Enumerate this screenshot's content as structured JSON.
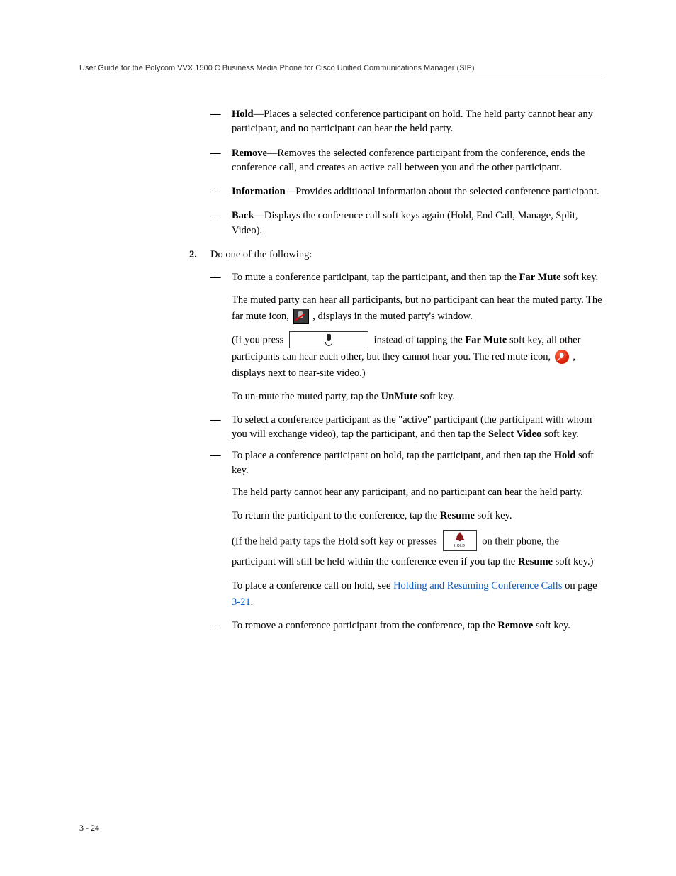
{
  "header": "User Guide for the Polycom VVX 1500 C Business Media Phone for Cisco Unified Communications Manager (SIP)",
  "items": {
    "hold": {
      "term": "Hold",
      "text": "—Places a selected conference participant on hold. The held party cannot hear any participant, and no participant can hear the held party."
    },
    "remove": {
      "term": "Remove",
      "text": "—Removes the selected conference participant from the conference, ends the conference call, and creates an active call between you and the other participant."
    },
    "information": {
      "term": "Information",
      "text": "—Provides additional information about the selected conference participant."
    },
    "back": {
      "term": "Back",
      "text": "—Displays the conference call soft keys again (Hold, End Call, Manage, Split, Video)."
    }
  },
  "step2": {
    "num": "2.",
    "lead": "Do one of the following:",
    "mute": {
      "p1a": "To mute a conference participant, tap the participant, and then tap the ",
      "p1b": "Far Mute",
      "p1c": " soft key.",
      "p2a": "The muted party can hear all participants, but no participant can hear the muted party. The far mute icon, ",
      "p2b": " , displays in the muted party's window.",
      "p3a": "(If you press ",
      "p3b": " instead of tapping the ",
      "p3c": "Far Mute",
      "p3d": " soft key, all other participants can hear each other, but they cannot hear you. The red mute icon, ",
      "p3e": " , displays next to near-site video.)",
      "p4a": "To un-mute the muted party, tap the ",
      "p4b": "UnMute",
      "p4c": " soft key."
    },
    "select": {
      "a": "To select a conference participant as the \"active\" participant (the participant with whom you will exchange video), tap the participant, and then tap the ",
      "b": "Select Video",
      "c": " soft key."
    },
    "holdp": {
      "p1a": "To place a conference participant on hold, tap the participant, and then tap the ",
      "p1b": "Hold",
      "p1c": " soft key.",
      "p2": "The held party cannot hear any participant, and no participant can hear the held party.",
      "p3a": "To return the participant to the conference, tap the ",
      "p3b": "Resume",
      "p3c": " soft key.",
      "p4a": "(If the held party taps the Hold soft key or presses ",
      "p4b": " on their phone, the participant will still be held within the conference even if you tap the ",
      "p4c": "Resume",
      "p4d": " soft key.)",
      "p5a": "To place a conference call on hold, see ",
      "p5link": "Holding and Resuming Conference Calls",
      "p5b": " on page ",
      "p5page": "3-21",
      "p5c": "."
    },
    "removep": {
      "a": "To remove a conference participant from the conference, tap the ",
      "b": "Remove",
      "c": " soft key."
    }
  },
  "dash": "—",
  "hold_key_label": "HOLD",
  "pagenum": "3 - 24"
}
